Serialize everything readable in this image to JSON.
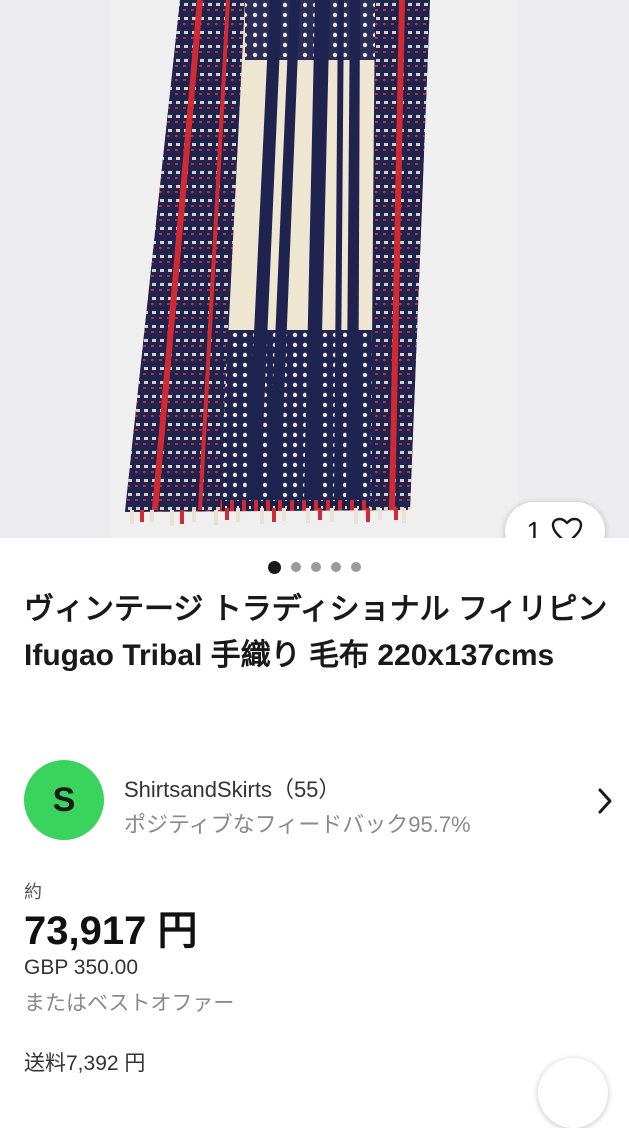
{
  "listing": {
    "image_count": 5,
    "active_image": 1,
    "watch_count": "1",
    "title": "ヴィンテージ トラディショナル フィリピン Ifugao Tribal 手織り 毛布 220x137cms",
    "seller": {
      "avatar_letter": "S",
      "avatar_color": "#3ad35e",
      "name": "ShirtsandSkirts（55）",
      "feedback": "ポジティブなフィードバック95.7%"
    },
    "price": {
      "approx_label": "約",
      "amount": "73,917 円",
      "original": "GBP 350.00",
      "best_offer": "またはベストオファー"
    },
    "shipping": "送料7,392 円"
  },
  "icons": {
    "watch": "heart-icon",
    "seller_link": "chevron-right-icon"
  }
}
